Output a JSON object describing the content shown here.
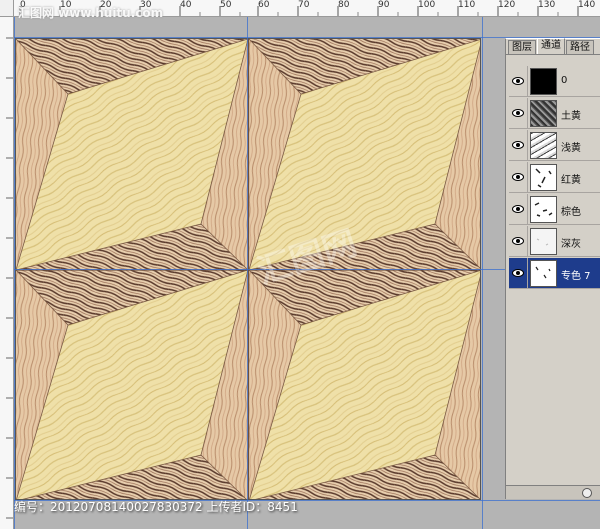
{
  "watermark": {
    "site": "汇图网 www.huitu.com",
    "center": "汇图网",
    "footer": "编号：20120708140027830372 上传者ID：8451"
  },
  "ruler": {
    "top_labels": [
      "0",
      "10",
      "20",
      "30",
      "40",
      "50",
      "60",
      "70",
      "80",
      "90",
      "100",
      "110",
      "120",
      "130",
      "140",
      "150"
    ]
  },
  "panel": {
    "tabs": [
      {
        "label": "图层",
        "active": false
      },
      {
        "label": "通道",
        "active": true
      },
      {
        "label": "路径",
        "active": false
      }
    ],
    "channels": [
      {
        "name": "0",
        "thumb": "black"
      },
      {
        "name": "土黄",
        "thumb": "noise-dark"
      },
      {
        "name": "浅黄",
        "thumb": "noise-light"
      },
      {
        "name": "红黄",
        "thumb": "sparse"
      },
      {
        "name": "棕色",
        "thumb": "sparse"
      },
      {
        "name": "深灰",
        "thumb": "light"
      },
      {
        "name": "专色 7",
        "thumb": "sparse",
        "selected": true
      }
    ]
  },
  "colors": {
    "wood_light": "#ecdca0",
    "wood_mid": "#d9b88a",
    "wood_dark": "#6b4a3a",
    "guide": "#3a6fd0",
    "selected": "#1e3c8c"
  }
}
